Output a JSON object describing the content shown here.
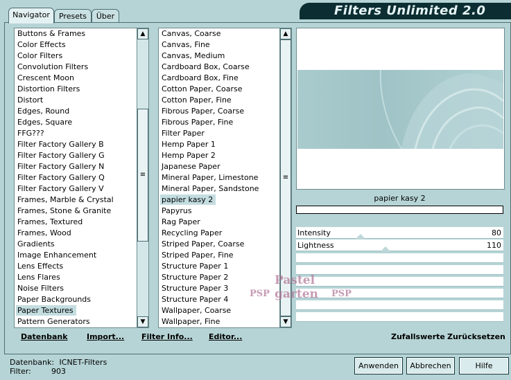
{
  "app": {
    "title": "Filters Unlimited 2.0"
  },
  "tabs": [
    {
      "label": "Navigator"
    },
    {
      "label": "Presets"
    },
    {
      "label": "Über"
    }
  ],
  "categories": [
    "Buttons & Frames",
    "Color Effects",
    "Color Filters",
    "Convolution Filters",
    "Crescent Moon",
    "Distortion Filters",
    "Distort",
    "Edges, Round",
    "Edges, Square",
    "FFG???",
    "Filter Factory Gallery B",
    "Filter Factory Gallery G",
    "Filter Factory Gallery N",
    "Filter Factory Gallery Q",
    "Filter Factory Gallery V",
    "Frames, Marble & Crystal",
    "Frames, Stone & Granite",
    "Frames, Textured",
    "Frames, Wood",
    "Gradients",
    "Image Enhancement",
    "Lens Effects",
    "Lens Flares",
    "Noise Filters",
    "Paper Backgrounds",
    "Paper Textures",
    "Pattern Generators"
  ],
  "selected_category_index": 25,
  "filters": [
    "Canvas, Coarse",
    "Canvas, Fine",
    "Canvas, Medium",
    "Cardboard Box, Coarse",
    "Cardboard Box, Fine",
    "Cotton Paper, Coarse",
    "Cotton Paper, Fine",
    "Fibrous Paper, Coarse",
    "Fibrous Paper, Fine",
    "Filter Paper",
    "Hemp Paper 1",
    "Hemp Paper 2",
    "Japanese Paper",
    "Mineral Paper, Limestone",
    "Mineral Paper, Sandstone",
    "papier kasy 2",
    "Papyrus",
    "Rag Paper",
    "Recycling Paper",
    "Striped Paper, Coarse",
    "Striped Paper, Fine",
    "Structure Paper 1",
    "Structure Paper 2",
    "Structure Paper 3",
    "Structure Paper 4",
    "Wallpaper, Coarse",
    "Wallpaper, Fine"
  ],
  "selected_filter_index": 15,
  "preview": {
    "caption": "papier kasy 2"
  },
  "sliders": [
    {
      "label": "Intensity",
      "value": "80",
      "fraction": 0.31
    },
    {
      "label": "Lightness",
      "value": "110",
      "fraction": 0.43
    }
  ],
  "toolbar": {
    "database": "Datenbank",
    "import": "Import...",
    "filter_info": "Filter Info...",
    "editor": "Editor...",
    "random": "Zufallswerte",
    "reset": "Zurücksetzen"
  },
  "status": {
    "db_label": "Datenbank:",
    "db_value": "ICNET-Filters",
    "filter_label": "Filter:",
    "filter_value": "903"
  },
  "buttons": {
    "apply": "Anwenden",
    "cancel": "Abbrechen",
    "help": "Hilfe"
  },
  "watermark": {
    "line1": "Pastel",
    "line2": "garten",
    "mark": "PSP"
  }
}
